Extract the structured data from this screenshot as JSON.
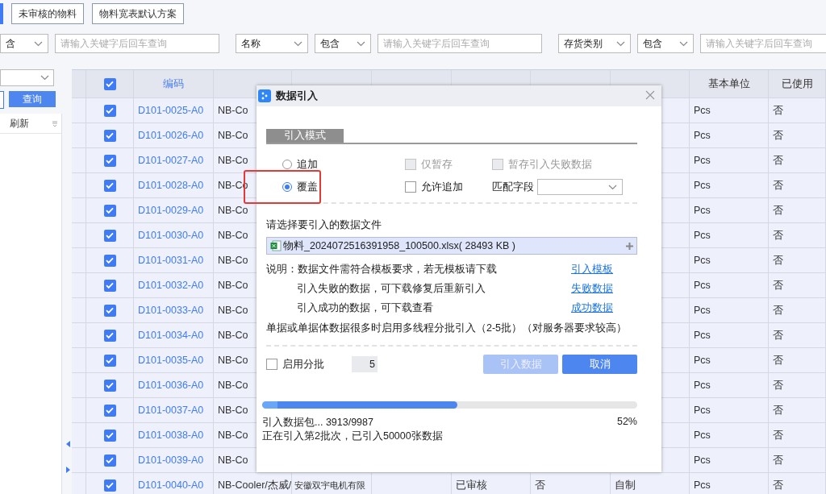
{
  "toolbar": {
    "active_marker": true,
    "buttons": [
      "未审核的物料",
      "物料宽表默认方案"
    ]
  },
  "filters": [
    {
      "operator": "含",
      "placeholder": "请输入关键字后回车查询"
    },
    {
      "field": "名称",
      "operator": "包含",
      "placeholder": "请输入关键字后回车查询"
    },
    {
      "field": "存货类别",
      "operator": "包含",
      "placeholder": "请输入关键字后回车查询"
    }
  ],
  "left_panel": {
    "query_button": "查询",
    "refresh": "刷新"
  },
  "table": {
    "header_checked": true,
    "code_column": "编码",
    "unit_column": "基本单位",
    "used_column": "已使用",
    "rows": [
      {
        "checked": true,
        "code": "D101-0025-A0",
        "column_3": "NB-Co",
        "unit": "Pcs",
        "used": "否"
      },
      {
        "checked": true,
        "code": "D101-0026-A0",
        "column_3": "NB-Co",
        "unit": "Pcs",
        "used": "否"
      },
      {
        "checked": true,
        "code": "D101-0027-A0",
        "column_3": "NB-Co",
        "unit": "Pcs",
        "used": "否"
      },
      {
        "checked": true,
        "code": "D101-0028-A0",
        "column_3": "NB-Co",
        "unit": "Pcs",
        "used": "否"
      },
      {
        "checked": true,
        "code": "D101-0029-A0",
        "column_3": "NB-Co",
        "unit": "Pcs",
        "used": "否"
      },
      {
        "checked": true,
        "code": "D101-0030-A0",
        "column_3": "NB-Co",
        "unit": "Pcs",
        "used": "否"
      },
      {
        "checked": true,
        "code": "D101-0031-A0",
        "column_3": "NB-Co",
        "unit": "Pcs",
        "used": "否"
      },
      {
        "checked": true,
        "code": "D101-0032-A0",
        "column_3": "NB-Co",
        "unit": "Pcs",
        "used": "否"
      },
      {
        "checked": true,
        "code": "D101-0033-A0",
        "column_3": "NB-Co",
        "unit": "Pcs",
        "used": "否"
      },
      {
        "checked": true,
        "code": "D101-0034-A0",
        "column_3": "NB-Co",
        "unit": "Pcs",
        "used": "否"
      },
      {
        "checked": true,
        "code": "D101-0035-A0",
        "column_3": "NB-Co",
        "unit": "Pcs",
        "used": "否"
      },
      {
        "checked": true,
        "code": "D101-0036-A0",
        "column_3": "NB-Co",
        "unit": "Pcs",
        "used": "否"
      },
      {
        "checked": true,
        "code": "D101-0037-A0",
        "column_3": "NB-Co",
        "unit": "Pcs",
        "used": "否"
      },
      {
        "checked": true,
        "code": "D101-0038-A0",
        "column_3": "NB-Co",
        "unit": "Pcs",
        "used": "否"
      },
      {
        "checked": true,
        "code": "D101-0039-A0",
        "column_3": "NB-Co",
        "unit": "Pcs",
        "used": "否"
      },
      {
        "checked": true,
        "code": "D101-0040-A0",
        "column_3": "NB-Cooler/杰威/",
        "column_4": "安徽双宇电机有限",
        "column_6": "已审核",
        "column_7": "否",
        "column_8": "自制",
        "unit": "Pcs",
        "used": "否"
      }
    ]
  },
  "dialog": {
    "title": "数据引入",
    "section": "引入模式",
    "mode_options": [
      {
        "label": "追加",
        "selected": false,
        "highlighted": false
      },
      {
        "label": "覆盖",
        "selected": true,
        "highlighted": true
      }
    ],
    "options": [
      {
        "label": "仅暂存",
        "checked": false,
        "disabled": true
      },
      {
        "label": "暂存引入失败数据",
        "checked": false,
        "disabled": true
      },
      {
        "label": "允许追加",
        "checked": false,
        "disabled": false
      }
    ],
    "match_field": {
      "label": "匹配字段"
    },
    "file_prompt": "请选择要引入的数据文件",
    "file": "物料_2024072516391958_100500.xlsx( 28493 KB )",
    "notes": [
      {
        "text": "说明：数据文件需符合模板要求，若无模板请下载",
        "link": "引入模板"
      },
      {
        "text": "引入失败的数据，可下载修复后重新引入",
        "link": "失败数据"
      },
      {
        "text": "引入成功的数据，可下载查看",
        "link": "成功数据"
      }
    ],
    "batch_hint": "单据或单据体数据很多时启用多线程分批引入（2-5批）（对服务器要求较高）",
    "batch": {
      "label": "启用分批",
      "checked": false,
      "count": "5"
    },
    "buttons": [
      {
        "label": "引入数据",
        "disabled": true
      },
      {
        "label": "取消",
        "disabled": false
      }
    ],
    "progress": {
      "level": 0.52,
      "status": "引入数据包... 3913/9987",
      "percent": "52%",
      "detail": "正在引入第2批次，已引入50000张数据"
    }
  }
}
